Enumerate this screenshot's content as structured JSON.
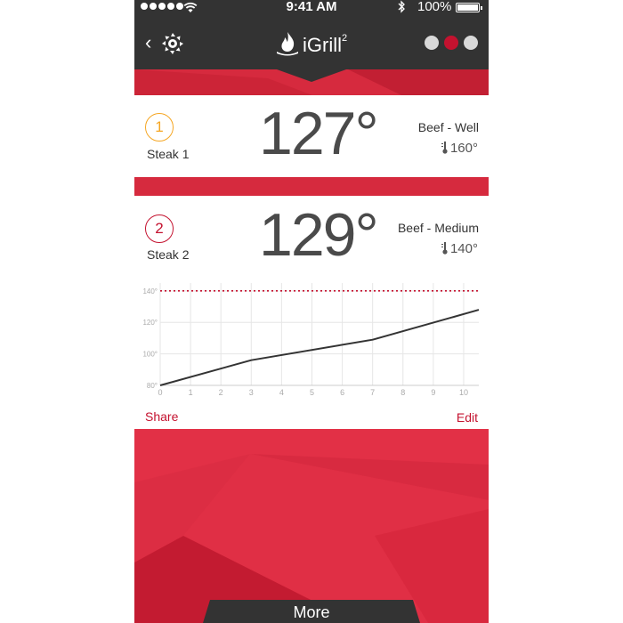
{
  "status": {
    "time": "9:41 AM",
    "battery": "100%"
  },
  "header": {
    "brand": "iGrill",
    "brand_sup": "2"
  },
  "probes": [
    {
      "number": "1",
      "name": "Steak 1",
      "temp": "127°",
      "preset": "Beef - Well",
      "target": "160°"
    },
    {
      "number": "2",
      "name": "Steak 2",
      "temp": "129°",
      "preset": "Beef - Medium",
      "target": "140°"
    }
  ],
  "chart_data": {
    "type": "line",
    "x": [
      0,
      3,
      7,
      10.5
    ],
    "values": [
      80,
      96,
      109,
      128
    ],
    "xlim": [
      0,
      10.5
    ],
    "ylim": [
      80,
      145
    ],
    "xticks": [
      "0",
      "1",
      "2",
      "3",
      "4",
      "5",
      "6",
      "7",
      "8",
      "9",
      "10"
    ],
    "yticks": [
      {
        "value": 80,
        "label": "80°"
      },
      {
        "value": 100,
        "label": "100°"
      },
      {
        "value": 120,
        "label": "120°"
      },
      {
        "value": 140,
        "label": "140°"
      }
    ],
    "target_line": 140,
    "grid": true,
    "colors": {
      "line": "#333333",
      "target": "#c4122f",
      "grid": "#e6e6e6"
    }
  },
  "actions": {
    "share": "Share",
    "edit": "Edit"
  },
  "footer": {
    "more": "More"
  },
  "colors": {
    "accent": "#c4122f",
    "bar": "#333333",
    "banner": "#d62a3e"
  }
}
